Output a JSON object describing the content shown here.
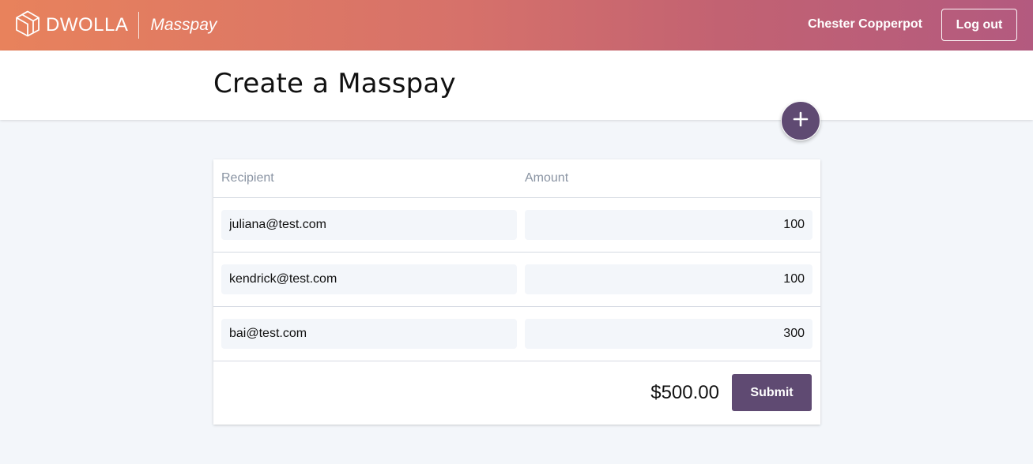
{
  "header": {
    "brand_name": "DWOLLA",
    "product_name": "Masspay",
    "user_name": "Chester Copperpot",
    "logout_label": "Log out",
    "gradient_colors": [
      "#e8825c",
      "#b35a7f"
    ]
  },
  "page": {
    "title": "Create a Masspay",
    "add_icon": "plus-icon"
  },
  "table": {
    "columns": [
      "Recipient",
      "Amount"
    ],
    "rows": [
      {
        "recipient": "juliana@test.com",
        "amount": "100"
      },
      {
        "recipient": "kendrick@test.com",
        "amount": "100"
      },
      {
        "recipient": "bai@test.com",
        "amount": "300"
      }
    ],
    "total": "$500.00",
    "submit_label": "Submit"
  },
  "colors": {
    "accent": "#5f4a72",
    "background": "#f3f6fa"
  }
}
